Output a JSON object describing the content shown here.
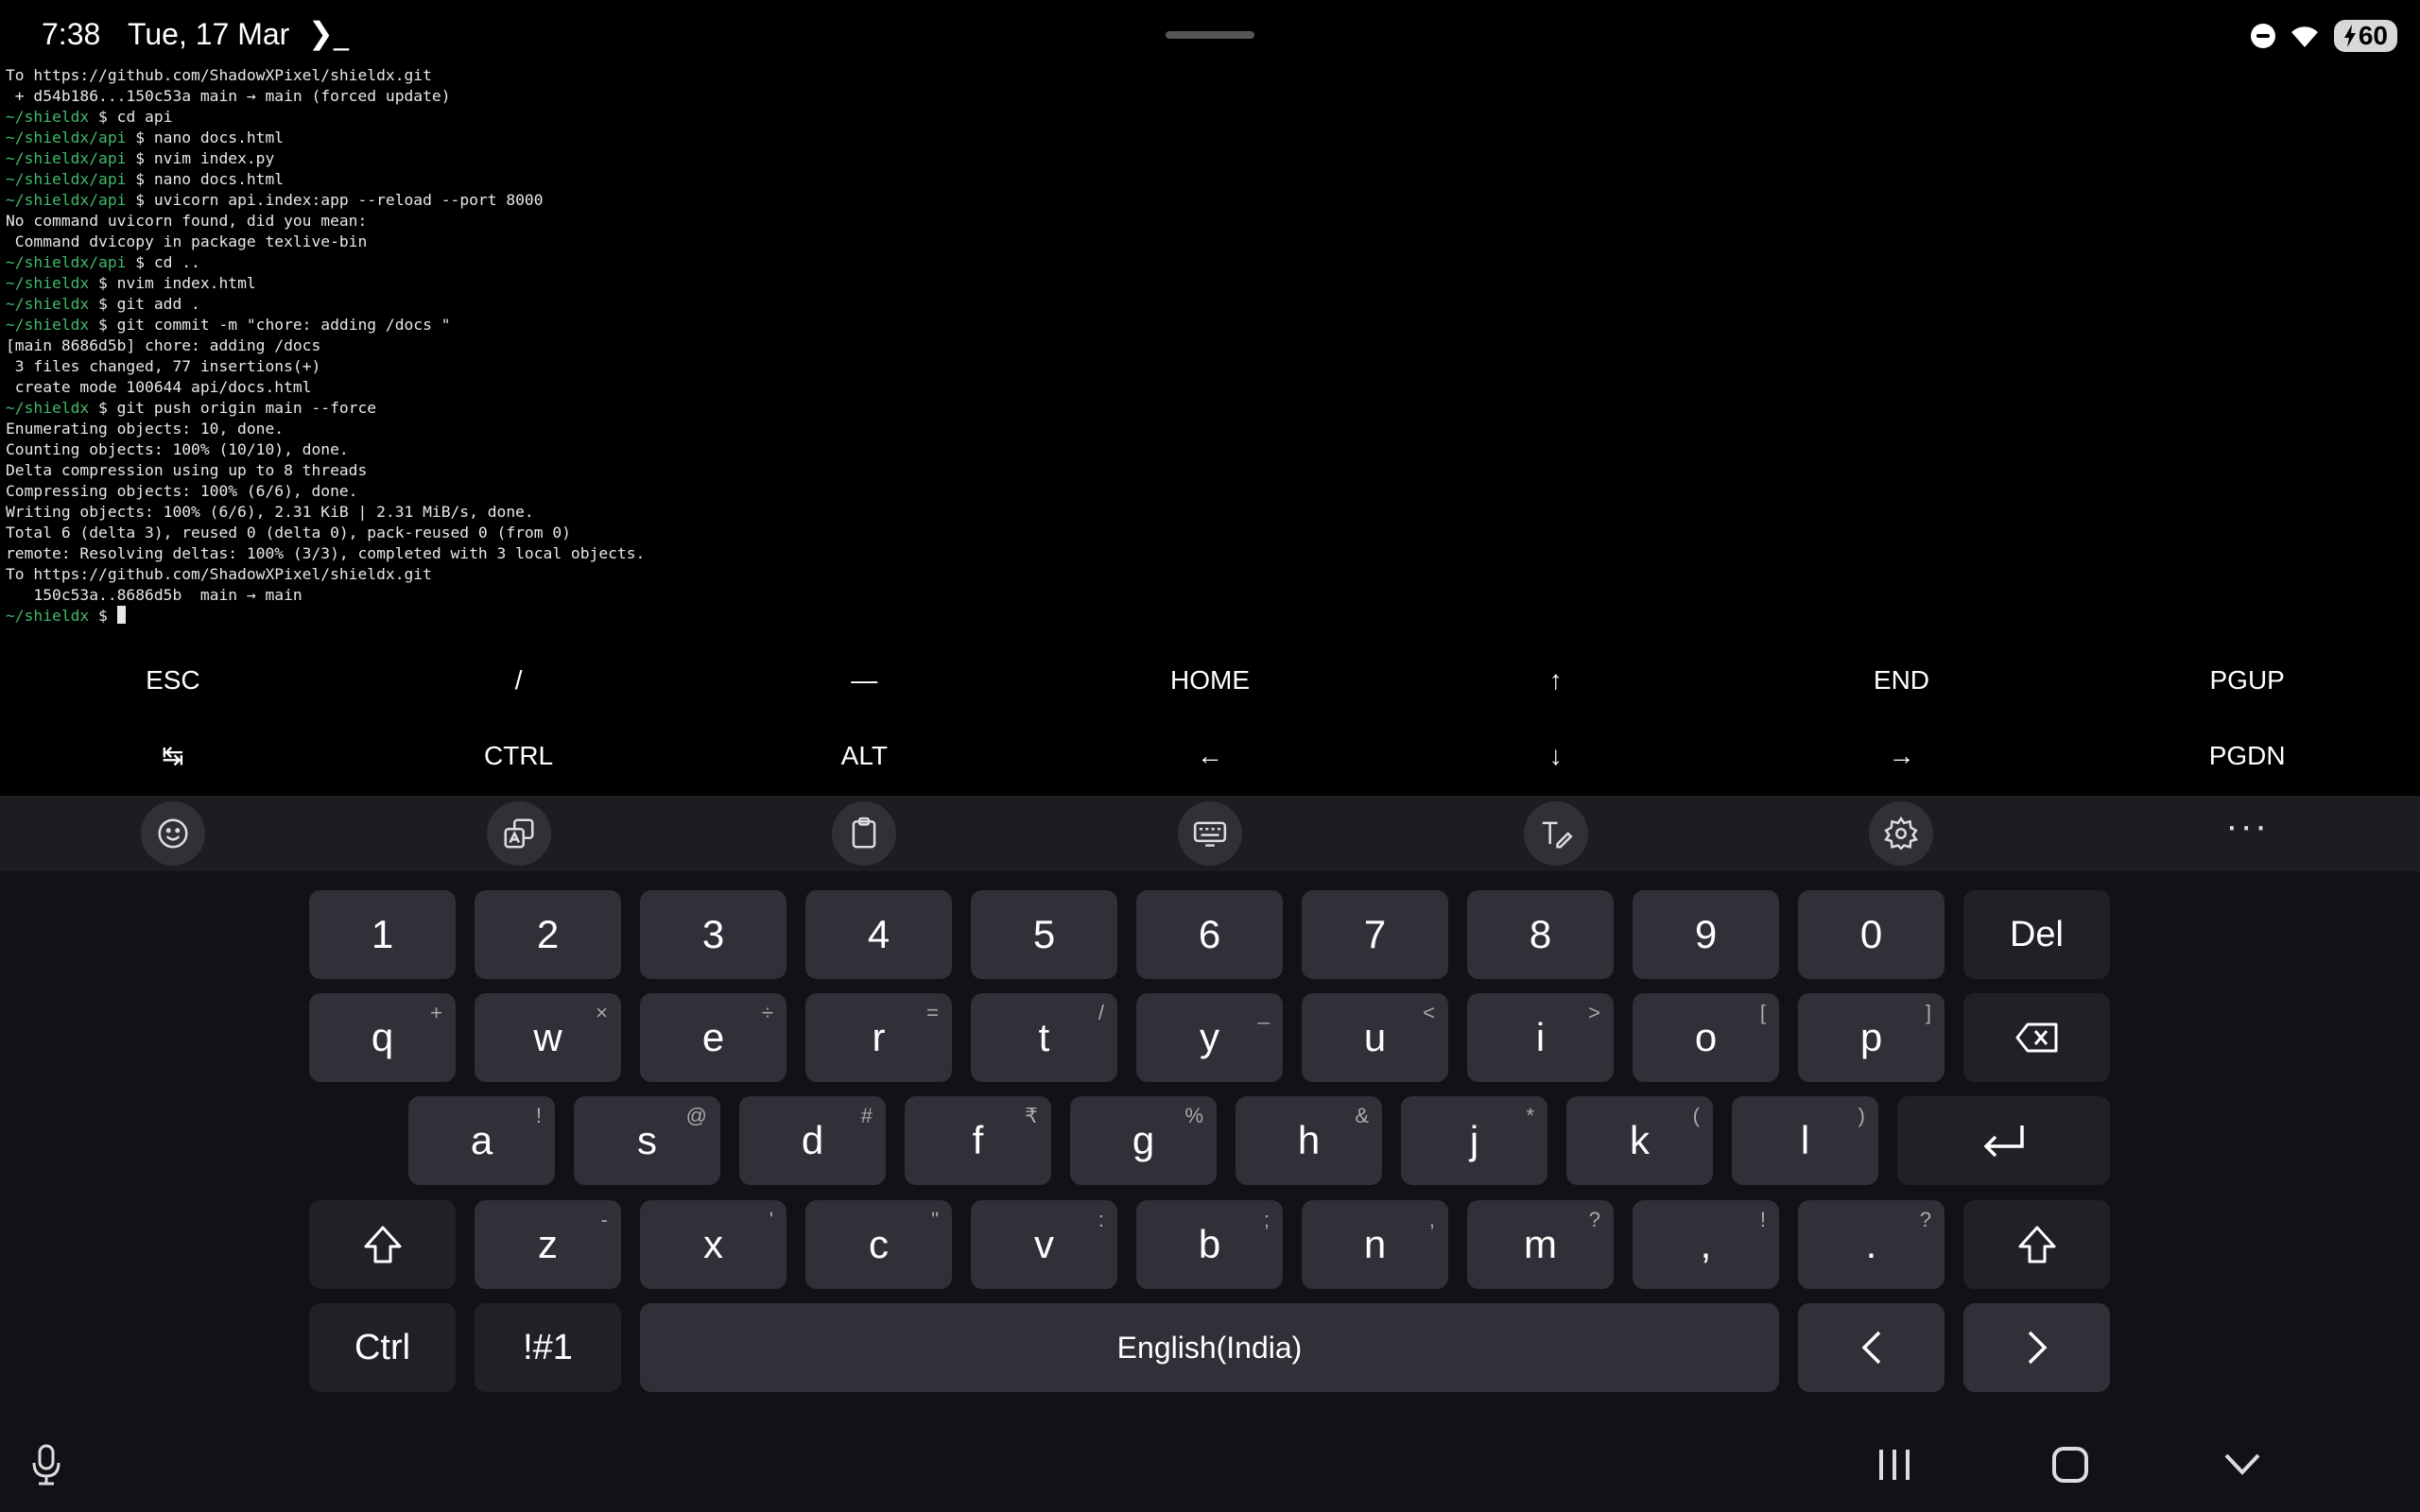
{
  "status": {
    "time": "7:38",
    "date": "Tue, 17 Mar",
    "term_glyph": "❯_",
    "battery": "60"
  },
  "terminal": {
    "lines": [
      {
        "prompt": "",
        "text": "To https://github.com/ShadowXPixel/shieldx.git"
      },
      {
        "prompt": "",
        "text": " + d54b186...150c53a main → main (forced update)"
      },
      {
        "prompt": "~/shieldx",
        "text": " $ cd api"
      },
      {
        "prompt": "~/shieldx/api",
        "text": " $ nano docs.html"
      },
      {
        "prompt": "~/shieldx/api",
        "text": " $ nvim index.py"
      },
      {
        "prompt": "~/shieldx/api",
        "text": " $ nano docs.html"
      },
      {
        "prompt": "~/shieldx/api",
        "text": " $ uvicorn api.index:app --reload --port 8000"
      },
      {
        "prompt": "",
        "text": "No command uvicorn found, did you mean:"
      },
      {
        "prompt": "",
        "text": " Command dvicopy in package texlive-bin"
      },
      {
        "prompt": "~/shieldx/api",
        "text": " $ cd .."
      },
      {
        "prompt": "~/shieldx",
        "text": " $ nvim index.html"
      },
      {
        "prompt": "~/shieldx",
        "text": " $ git add ."
      },
      {
        "prompt": "~/shieldx",
        "text": " $ git commit -m \"chore: adding /docs \""
      },
      {
        "prompt": "",
        "text": "[main 8686d5b] chore: adding /docs"
      },
      {
        "prompt": "",
        "text": " 3 files changed, 77 insertions(+)"
      },
      {
        "prompt": "",
        "text": " create mode 100644 api/docs.html"
      },
      {
        "prompt": "~/shieldx",
        "text": " $ git push origin main --force"
      },
      {
        "prompt": "",
        "text": "Enumerating objects: 10, done."
      },
      {
        "prompt": "",
        "text": "Counting objects: 100% (10/10), done."
      },
      {
        "prompt": "",
        "text": "Delta compression using up to 8 threads"
      },
      {
        "prompt": "",
        "text": "Compressing objects: 100% (6/6), done."
      },
      {
        "prompt": "",
        "text": "Writing objects: 100% (6/6), 2.31 KiB | 2.31 MiB/s, done."
      },
      {
        "prompt": "",
        "text": "Total 6 (delta 3), reused 0 (delta 0), pack-reused 0 (from 0)"
      },
      {
        "prompt": "",
        "text": "remote: Resolving deltas: 100% (3/3), completed with 3 local objects."
      },
      {
        "prompt": "",
        "text": "To https://github.com/ShadowXPixel/shieldx.git"
      },
      {
        "prompt": "",
        "text": "   150c53a..8686d5b  main → main"
      },
      {
        "prompt": "~/shieldx",
        "text": " $ "
      }
    ]
  },
  "extra_keys": {
    "row1": [
      "ESC",
      "/",
      "—",
      "HOME",
      "↑",
      "END",
      "PGUP"
    ],
    "row2": [
      "↹",
      "CTRL",
      "ALT",
      "←",
      "↓",
      "→",
      "PGDN"
    ]
  },
  "toolbar": {
    "icons": [
      "emoji-icon",
      "translate-icon",
      "clipboard-icon",
      "keyboard-mode-icon",
      "handwriting-icon",
      "settings-icon"
    ],
    "more": "···"
  },
  "keyboard": {
    "numbers": [
      "1",
      "2",
      "3",
      "4",
      "5",
      "6",
      "7",
      "8",
      "9",
      "0"
    ],
    "del": "Del",
    "row_q": [
      {
        "k": "q",
        "s": "+"
      },
      {
        "k": "w",
        "s": "×"
      },
      {
        "k": "e",
        "s": "÷"
      },
      {
        "k": "r",
        "s": "="
      },
      {
        "k": "t",
        "s": "/"
      },
      {
        "k": "y",
        "s": "_"
      },
      {
        "k": "u",
        "s": "<"
      },
      {
        "k": "i",
        "s": ">"
      },
      {
        "k": "o",
        "s": "["
      },
      {
        "k": "p",
        "s": "]"
      }
    ],
    "row_a": [
      {
        "k": "a",
        "s": "!"
      },
      {
        "k": "s",
        "s": "@"
      },
      {
        "k": "d",
        "s": "#"
      },
      {
        "k": "f",
        "s": "₹"
      },
      {
        "k": "g",
        "s": "%"
      },
      {
        "k": "h",
        "s": "&"
      },
      {
        "k": "j",
        "s": "*"
      },
      {
        "k": "k",
        "s": "("
      },
      {
        "k": "l",
        "s": ")"
      }
    ],
    "row_z": [
      {
        "k": "z",
        "s": "-"
      },
      {
        "k": "x",
        "s": "'"
      },
      {
        "k": "c",
        "s": "\""
      },
      {
        "k": "v",
        "s": ":"
      },
      {
        "k": "b",
        "s": ";"
      },
      {
        "k": "n",
        "s": ","
      },
      {
        "k": "m",
        "s": "?"
      },
      {
        "k": ",",
        "s": "!"
      },
      {
        "k": ".",
        "s": "?"
      }
    ],
    "ctrl": "Ctrl",
    "symbols": "!#1",
    "space": "English(India)"
  }
}
